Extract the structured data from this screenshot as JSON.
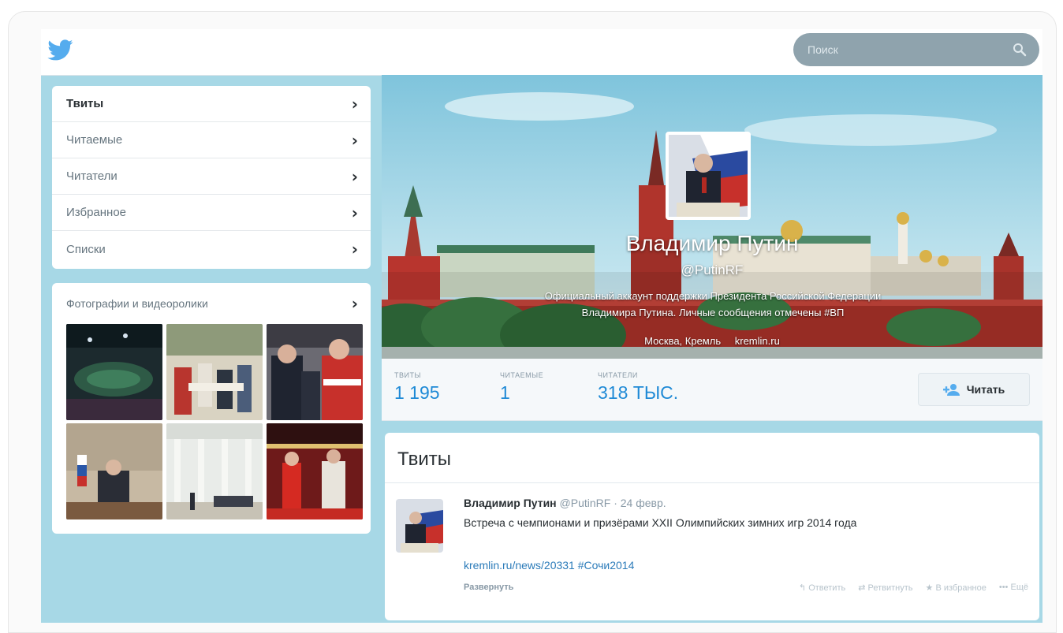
{
  "search": {
    "placeholder": "Поиск"
  },
  "sidebar": {
    "items": [
      {
        "label": "Твиты",
        "active": true
      },
      {
        "label": "Читаемые"
      },
      {
        "label": "Читатели"
      },
      {
        "label": "Избранное"
      },
      {
        "label": "Списки"
      }
    ],
    "media_title": "Фотографии и видеоролики"
  },
  "profile": {
    "name": "Владимир Путин",
    "handle": "@PutinRF",
    "bio_line1": "Официальный аккаунт поддержки Президента Российской Федерации",
    "bio_line2": "Владимира Путина. Личные сообщения отмечены #ВП",
    "location": "Москва, Кремль",
    "website": "kremlin.ru"
  },
  "stats": {
    "tweets_label": "ТВИТЫ",
    "tweets_value": "1 195",
    "following_label": "ЧИТАЕМЫЕ",
    "following_value": "1",
    "followers_label": "ЧИТАТЕЛИ",
    "followers_value": "318 ТЫС.",
    "follow_button": "Читать"
  },
  "timeline": {
    "heading": "Твиты",
    "tweet": {
      "name": "Владимир Путин",
      "handle": "@PutinRF",
      "date": "· 24 февр.",
      "text": "Встреча с чемпионами и призёрами XXII Олимпийских зимних игр 2014 года",
      "link": "kremlin.ru/news/20331 #Сочи2014",
      "expand": "Развернуть",
      "actions": {
        "reply": "Ответить",
        "retweet": "Ретвитнуть",
        "favorite": "В избранное",
        "more": "Ещё"
      }
    }
  },
  "colors": {
    "accent": "#1f8ad6",
    "page_bg": "#a7d8e6",
    "kremlin_red": "#b8352e"
  }
}
